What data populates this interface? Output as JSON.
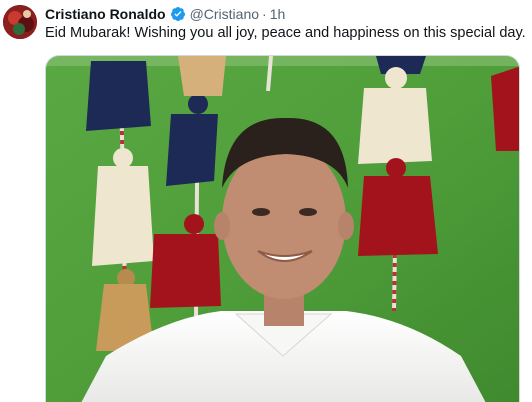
{
  "author": {
    "name": "Cristiano Ronaldo",
    "handle": "@Cristiano",
    "time": "1h",
    "verified": true,
    "badge_color": "#1d9bf0"
  },
  "tweet": {
    "text": "Eid Mubarak! Wishing you all joy, peace and happiness on this special day."
  },
  "media": {
    "description_icon": "photo",
    "colors": {
      "background_green": "#4f9e3a",
      "shirt": "#f4f4f2",
      "tassel_red": "#a3131c",
      "tassel_navy": "#1d2a55",
      "tassel_cream": "#efe6cf"
    }
  }
}
